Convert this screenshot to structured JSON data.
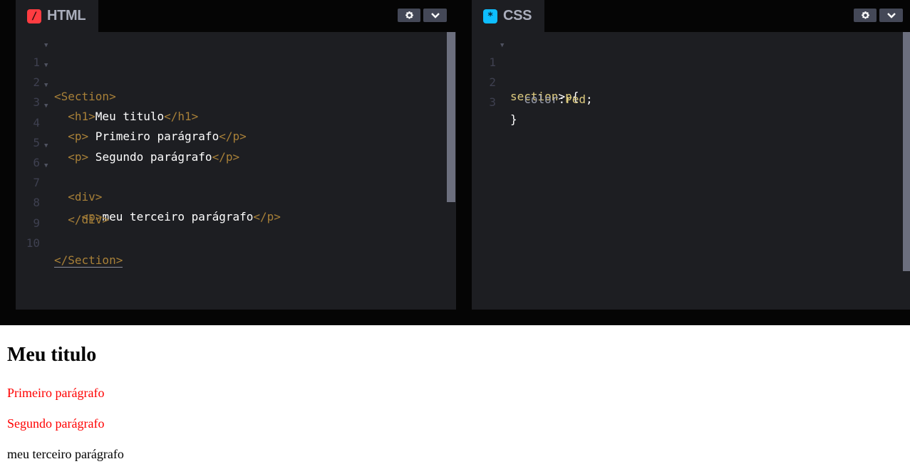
{
  "html_panel": {
    "tab_label": "HTML",
    "icon_glyph": "/",
    "icon_color": "#ff3c41",
    "lines": [
      {
        "num": "1",
        "fold": true
      },
      {
        "num": "2",
        "fold": true
      },
      {
        "num": "3",
        "fold": true
      },
      {
        "num": "4",
        "fold": true
      },
      {
        "num": "5",
        "fold": false
      },
      {
        "num": "6",
        "fold": true
      },
      {
        "num": "7",
        "fold": true
      },
      {
        "num": "8",
        "fold": false
      },
      {
        "num": "9",
        "fold": false
      },
      {
        "num": "10",
        "fold": false
      }
    ],
    "code": {
      "l1_tag": "<Section>",
      "l2_open": "<h1>",
      "l2_text": "Meu titulo",
      "l2_close": "</h1>",
      "l3_open": "<p>",
      "l3_text": " Primeiro parágrafo",
      "l3_close": "</p>",
      "l4_open": "<p>",
      "l4_text": " Segundo parágrafo",
      "l4_close": "</p>",
      "l6_tag": "<div>",
      "l7_open": "<p>",
      "l7_text": "meu terceiro parágrafo",
      "l7_close": "</p>",
      "l8_tag": "</div>",
      "l10_tag": "</Section>"
    }
  },
  "css_panel": {
    "tab_label": "CSS",
    "icon_glyph": "*",
    "icon_color": "#0ebeff",
    "lines": [
      {
        "num": "1",
        "fold": true
      },
      {
        "num": "2",
        "fold": false
      },
      {
        "num": "3",
        "fold": false
      }
    ],
    "code": {
      "l1_sel_a": "section",
      "l1_op": ">",
      "l1_sel_b": "p",
      "l1_brace": "{",
      "l2_prop": "color",
      "l2_colon": ":",
      "l2_val": "red",
      "l2_semi": ";",
      "l3_brace": "}"
    }
  },
  "controls": {
    "settings_icon": "gear-icon",
    "collapse_icon": "chevron-down-icon"
  },
  "preview": {
    "heading": "Meu titulo",
    "p1": "Primeiro parágrafo",
    "p2": "Segundo parágrafo",
    "p3": "meu terceiro parágrafo"
  },
  "colors": {
    "editor_bg": "#1d1e22",
    "tag": "#a88038",
    "selector": "#ddca7e",
    "preview_red": "#ff0000"
  }
}
